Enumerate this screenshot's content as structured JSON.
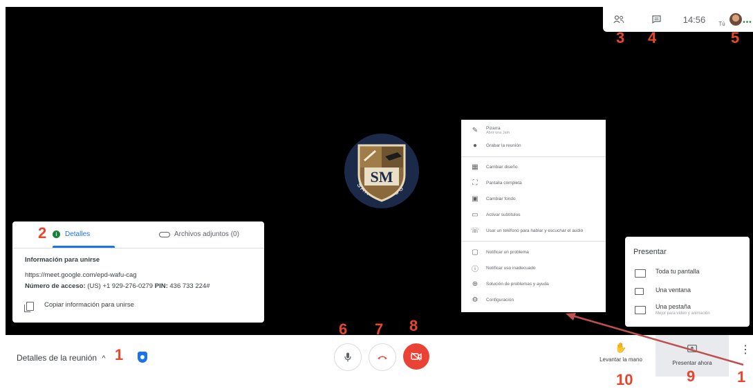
{
  "topbar": {
    "time": "14:56",
    "you_label": "Tú",
    "icons": [
      "people-icon",
      "chat-icon",
      "avatar"
    ]
  },
  "annotations": [
    "1",
    "2",
    "3",
    "4",
    "5",
    "6",
    "7",
    "8",
    "9",
    "10",
    "1"
  ],
  "logo": {
    "initials": "SM",
    "ring_text": "SAN MARCOS"
  },
  "details_panel": {
    "tabs": [
      {
        "label": "Detalles",
        "active": true
      },
      {
        "label": "Archivos adjuntos (0)",
        "active": false
      }
    ],
    "heading": "Información para unirse",
    "url": "https://meet.google.com/epd-wafu-cag",
    "access_label": "Número de acceso:",
    "access_value": "(US) +1 929-276-0279",
    "pin_label": "PIN:",
    "pin_value": "436 733 224#",
    "copy_label": "Copiar información para unirse"
  },
  "options_menu": {
    "items": [
      {
        "label": "Pizarra",
        "sublabel": "Abrir una Jam",
        "icon": "pencil-icon"
      },
      {
        "label": "Grabar la reunión",
        "icon": "record-icon"
      },
      {
        "label": "Cambiar diseño",
        "icon": "layout-icon"
      },
      {
        "label": "Pantalla completa",
        "icon": "fullscreen-icon"
      },
      {
        "label": "Cambiar fondo",
        "icon": "background-icon"
      },
      {
        "label": "Activar subtítulos",
        "icon": "captions-icon"
      },
      {
        "label": "Usar un teléfono para hablar y escuchar el audio",
        "icon": "phone-icon"
      },
      {
        "label": "Notificar un problema",
        "icon": "feedback-icon"
      },
      {
        "label": "Notificar uso inadecuado",
        "icon": "report-icon"
      },
      {
        "label": "Solución de problemas y ayuda",
        "icon": "troubleshoot-icon"
      },
      {
        "label": "Configuración",
        "icon": "gear-icon"
      }
    ]
  },
  "present_panel": {
    "title": "Presentar",
    "options": [
      {
        "label": "Toda tu pantalla",
        "sublabel": ""
      },
      {
        "label": "Una ventana",
        "sublabel": ""
      },
      {
        "label": "Una pestaña",
        "sublabel": "Mejor para vídeo y animación"
      }
    ]
  },
  "bottom_bar": {
    "meeting_details_label": "Detalles de la reunión",
    "raise_hand_label": "Levantar la mano",
    "present_now_label": "Presentar ahora",
    "colors": {
      "end_call": "#ea4335",
      "camera_off": "#ea4335",
      "accent": "#1a73e8"
    }
  }
}
